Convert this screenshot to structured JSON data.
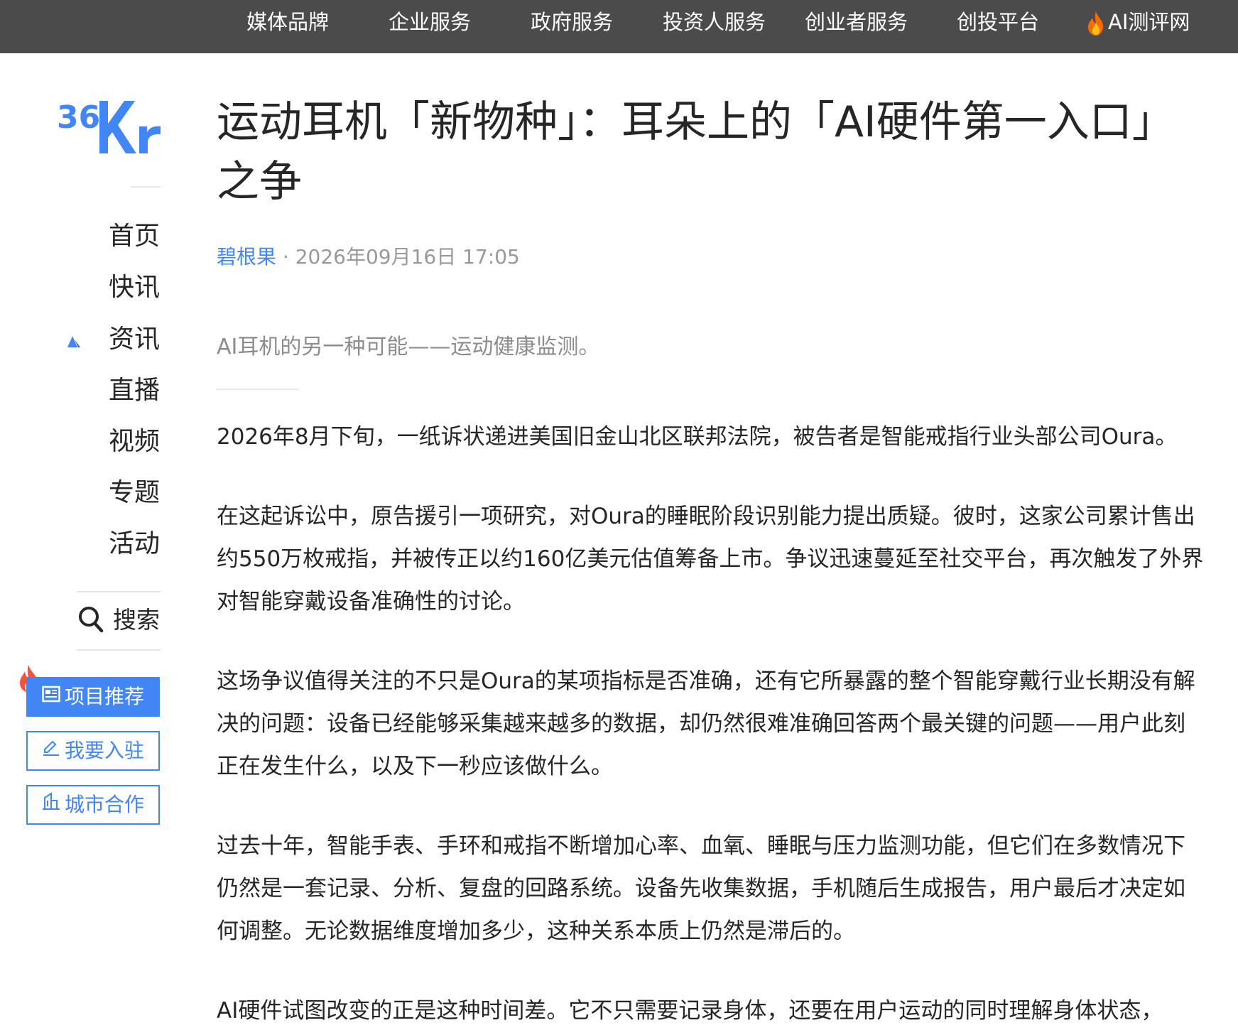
{
  "top_nav": {
    "items": [
      "媒体品牌",
      "企业服务",
      "政府服务",
      "投资人服务",
      "创业者服务",
      "创投平台",
      "AI测评网"
    ],
    "fire_item_index": 6
  },
  "logo": {
    "text": "36Kr",
    "icon": "36kr-logo",
    "color": "#4285f4"
  },
  "side_nav": {
    "items": [
      "首页",
      "快讯",
      "资讯",
      "直播",
      "视频",
      "专题",
      "活动"
    ],
    "active_index": 2,
    "active_icon": "triangle-up-icon",
    "search_label": "搜索",
    "search_icon": "search-icon"
  },
  "side_buttons": {
    "project": {
      "label": "项目推荐",
      "icon": "news-icon"
    },
    "join": {
      "label": "我要入驻",
      "icon": "pen-icon"
    },
    "city": {
      "label": "城市合作",
      "icon": "building-icon"
    },
    "hot_icon": "flame-icon"
  },
  "article": {
    "title": "运动耳机「新物种」：耳朵上的「AI硬件第一入口」之争",
    "author": "碧根果",
    "meta_sep": " · ",
    "date": "2026年09月16日 17:05",
    "summary": "AI耳机的另一种可能——运动健康监测。",
    "paragraphs": [
      "2026年8月下旬，一纸诉状递进美国旧金山北区联邦法院，被告者是智能戒指行业头部公司Oura。",
      "在这起诉讼中，原告援引一项研究，对Oura的睡眠阶段识别能力提出质疑。彼时，这家公司累计售出约550万枚戒指，并被传正以约160亿美元估值筹备上市。争议迅速蔓延至社交平台，再次触发了外界对智能穿戴设备准确性的讨论。",
      "这场争议值得关注的不只是Oura的某项指标是否准确，还有它所暴露的整个智能穿戴行业长期没有解决的问题：设备已经能够采集越来越多的数据，却仍然很难准确回答两个最关键的问题——用户此刻正在发生什么，以及下一秒应该做什么。",
      "过去十年，智能手表、手环和戒指不断增加心率、血氧、睡眠与压力监测功能，但它们在多数情况下仍然是一套记录、分析、复盘的回路系统。设备先收集数据，手机随后生成报告，用户最后才决定如何调整。无论数据维度增加多少，这种关系本质上仍然是滞后的。",
      "AI硬件试图改变的正是这种时间差。它不只需要记录身体，还要在用户运动的同时理解身体状态，"
    ]
  },
  "colors": {
    "topbar": "#4b4b4b",
    "accent": "#4285f4",
    "text": "#262626",
    "muted": "#999999",
    "flame": "#f5533d"
  }
}
